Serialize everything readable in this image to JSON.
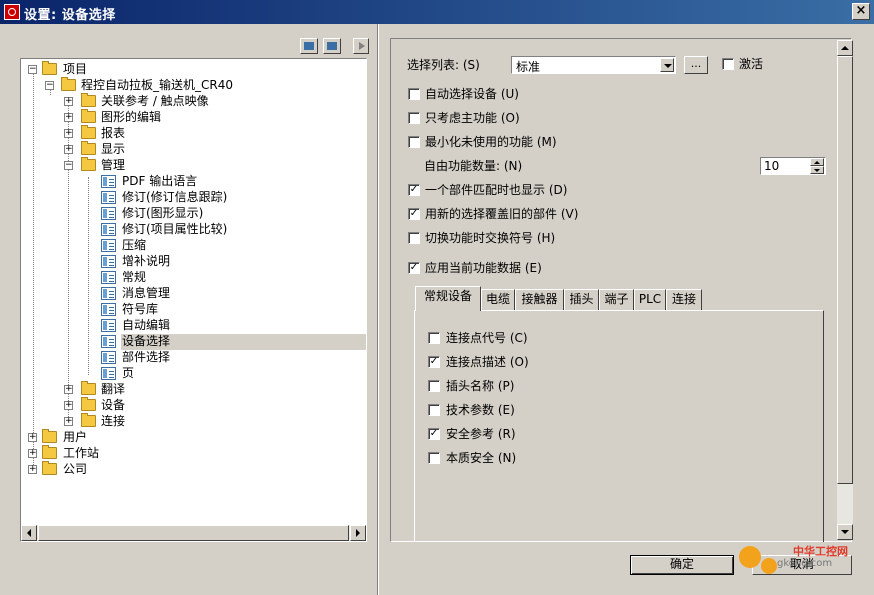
{
  "window": {
    "title": "设置: 设备选择",
    "close": "×"
  },
  "tree": {
    "items": [
      {
        "label": "项目"
      },
      {
        "label": "程控自动拉板_输送机_CR40"
      },
      {
        "label": "关联参考 / 触点映像"
      },
      {
        "label": "图形的编辑"
      },
      {
        "label": "报表"
      },
      {
        "label": "显示"
      },
      {
        "label": "管理"
      },
      {
        "label": "PDF 输出语言"
      },
      {
        "label": "修订(修订信息跟踪)"
      },
      {
        "label": "修订(图形显示)"
      },
      {
        "label": "修订(项目属性比较)"
      },
      {
        "label": "压缩"
      },
      {
        "label": "增补说明"
      },
      {
        "label": "常规"
      },
      {
        "label": "消息管理"
      },
      {
        "label": "符号库"
      },
      {
        "label": "自动编辑"
      },
      {
        "label": "设备选择"
      },
      {
        "label": "部件选择"
      },
      {
        "label": "页"
      },
      {
        "label": "翻译"
      },
      {
        "label": "设备"
      },
      {
        "label": "连接"
      },
      {
        "label": "用户"
      },
      {
        "label": "工作站"
      },
      {
        "label": "公司"
      }
    ]
  },
  "settings": {
    "select_list_label": "选择列表: (S)",
    "select_list_value": "标准",
    "dots": "...",
    "activate_label": "激活",
    "auto_select": "自动选择设备 (U)",
    "only_main": "只考虑主功能 (O)",
    "minimize_unused": "最小化未使用的功能 (M)",
    "free_count_label": "自由功能数量: (N)",
    "free_count_value": "10",
    "show_single_match": "一个部件匹配时也显示 (D)",
    "overwrite_parts": "用新的选择覆盖旧的部件 (V)",
    "switch_symbol": "切换功能时交换符号 (H)",
    "apply_current": "应用当前功能数据 (E)"
  },
  "tabs": [
    {
      "label": "常规设备"
    },
    {
      "label": "电缆"
    },
    {
      "label": "接触器"
    },
    {
      "label": "插头"
    },
    {
      "label": "端子"
    },
    {
      "label": "PLC"
    },
    {
      "label": "连接"
    }
  ],
  "tab_options": [
    {
      "label": "连接点代号 (C)",
      "checked": false
    },
    {
      "label": "连接点描述 (O)",
      "checked": true
    },
    {
      "label": "插头名称 (P)",
      "checked": false
    },
    {
      "label": "技术参数 (E)",
      "checked": false
    },
    {
      "label": "安全参考 (R)",
      "checked": true
    },
    {
      "label": "本质安全 (N)",
      "checked": false
    }
  ],
  "buttons": {
    "ok": "确定",
    "cancel": "取消"
  },
  "watermark": {
    "brand": "中华工控网",
    "domain": "gkong.com"
  },
  "check_mark": "✓",
  "colors": {
    "titlebar_start": "#0a246a",
    "titlebar_end": "#3a6ea5",
    "face": "#d4d0c8"
  }
}
